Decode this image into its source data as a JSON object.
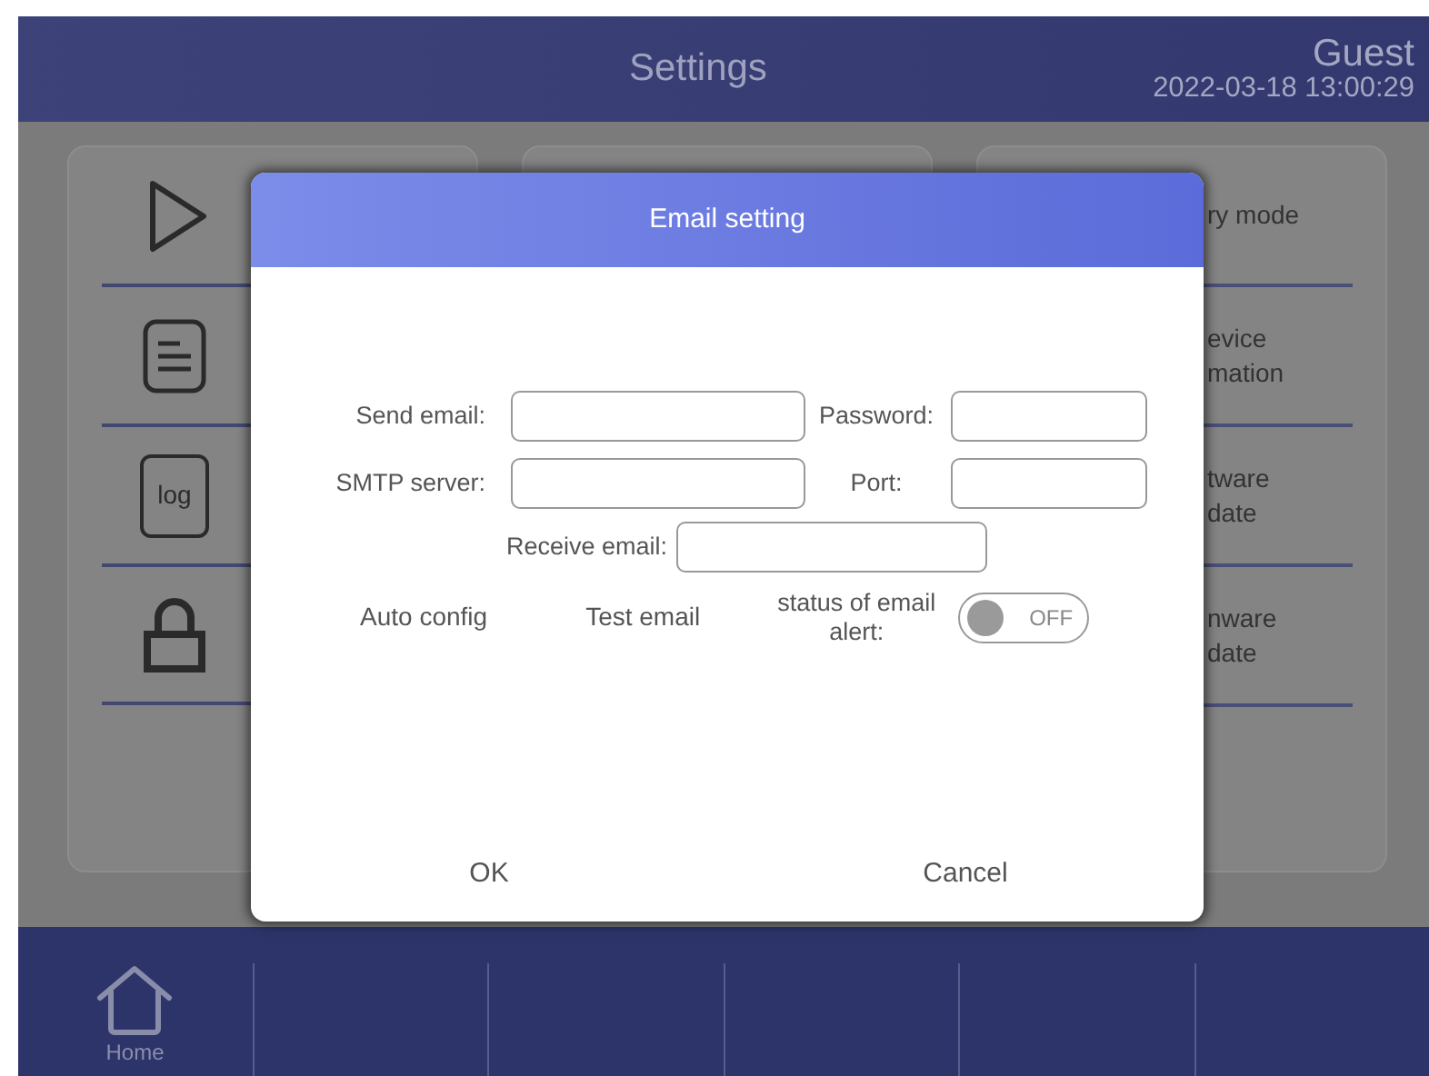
{
  "header": {
    "title": "Settings",
    "user": "Guest",
    "datetime": "2022-03-18 13:00:29"
  },
  "left_panel": {
    "items": [
      {
        "kind": "play"
      },
      {
        "kind": "document"
      },
      {
        "kind": "log",
        "icon_text": "log"
      },
      {
        "kind": "lock"
      }
    ]
  },
  "right_panel": {
    "items": [
      {
        "label": "ry mode"
      },
      {
        "label": "evice\nmation"
      },
      {
        "label": "tware\ndate"
      },
      {
        "label": "nware\ndate"
      }
    ]
  },
  "dialog": {
    "title": "Email setting",
    "rows": [
      {
        "fields": [
          {
            "label": "Send email:"
          },
          {
            "label": "Password:"
          }
        ]
      },
      {
        "fields": [
          {
            "label": "SMTP server:"
          },
          {
            "label": "Port:"
          }
        ]
      },
      {
        "fields": [
          {
            "label": "Receive email:"
          }
        ]
      }
    ],
    "actions": [
      "Auto config",
      "Test email"
    ],
    "alert_toggle": {
      "label": "status of email alert:",
      "state_text": "OFF",
      "on": false
    },
    "buttons": [
      "OK",
      "Cancel"
    ]
  },
  "bottom_nav": {
    "items": [
      {
        "kind": "home",
        "label": "Home"
      },
      {
        "kind": "empty"
      },
      {
        "kind": "empty"
      },
      {
        "kind": "empty"
      },
      {
        "kind": "empty"
      },
      {
        "kind": "empty"
      }
    ]
  }
}
